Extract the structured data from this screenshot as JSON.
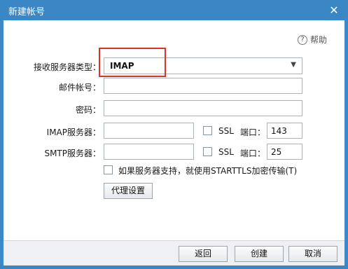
{
  "window": {
    "title": "新建帐号"
  },
  "help": {
    "label": "帮助"
  },
  "form": {
    "server_type": {
      "label": "接收服务器类型：",
      "value": "IMAP"
    },
    "account": {
      "label": "邮件帐号：",
      "value": ""
    },
    "password": {
      "label": "密码：",
      "value": ""
    },
    "imap": {
      "label": "IMAP服务器：",
      "value": "",
      "ssl_label": "SSL",
      "port_label": "端口：",
      "port": "143"
    },
    "smtp": {
      "label": "SMTP服务器：",
      "value": "",
      "ssl_label": "SSL",
      "port_label": "端口：",
      "port": "25"
    },
    "starttls": {
      "label": "如果服务器支持，就使用STARTTLS加密传输(T)"
    },
    "proxy_button": "代理设置"
  },
  "footer": {
    "back": "返回",
    "create": "创建",
    "cancel": "取消"
  },
  "colors": {
    "titlebar": "#3b86c5",
    "highlight": "#e0302a",
    "footer": "#eef0f3"
  }
}
